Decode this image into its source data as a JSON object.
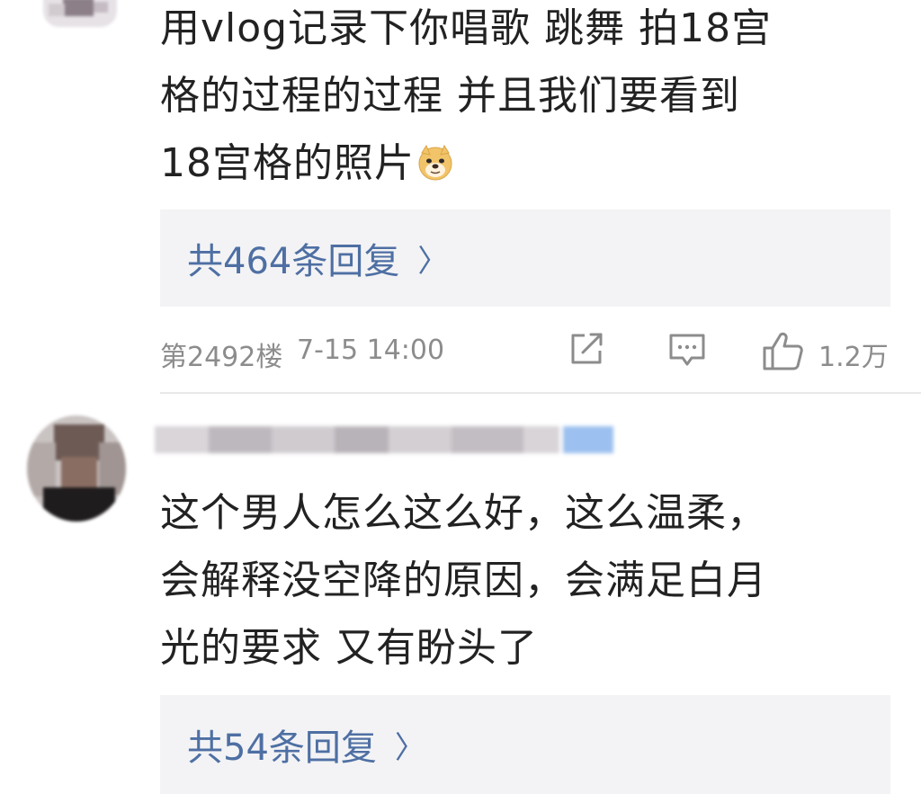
{
  "comments": [
    {
      "text_lines": [
        "用vlog记录下你唱歌 跳舞  拍18宫",
        "格的过程的过程  并且我们要看到",
        "18宫格的照片"
      ],
      "emoji_icon": "doge-emoji-icon",
      "replies_label": "共464条回复",
      "floor": "第2492楼",
      "time": "7-15 14:00",
      "like_count": "1.2万"
    },
    {
      "text_lines": [
        "这个男人怎么这么好，这么温柔，",
        "会解释没空降的原因，会满足白月",
        "光的要求 又有盼头了"
      ],
      "replies_label": "共54条回复"
    }
  ],
  "icons": {
    "share": "share-icon",
    "comment": "comment-icon",
    "like": "thumbs-up-icon",
    "chevron": "chevron-right-icon"
  },
  "colors": {
    "link": "#4e6fa3",
    "meta_text": "#8c8c8c",
    "reply_bg": "#f3f3f5",
    "body_text": "#222222"
  },
  "chevron_glyph": "〉"
}
